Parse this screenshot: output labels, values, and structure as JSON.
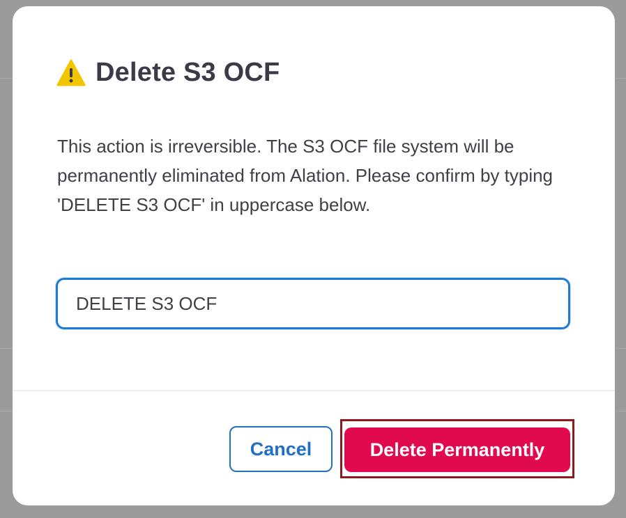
{
  "modal": {
    "title": "Delete S3 OCF",
    "icon": "warning-icon",
    "message": "This action is irreversible. The S3 OCF file system will be permanently eliminated from Alation. Please confirm by typing 'DELETE S3 OCF' in uppercase below.",
    "confirm_input": {
      "value": "DELETE S3 OCF",
      "placeholder": ""
    },
    "buttons": {
      "cancel_label": "Cancel",
      "delete_label": "Delete Permanently"
    }
  },
  "colors": {
    "warning_icon": "#f2c500",
    "primary_blue": "#1f6fc5",
    "danger": "#e20a4f",
    "highlight_frame": "#8e1a1c"
  }
}
